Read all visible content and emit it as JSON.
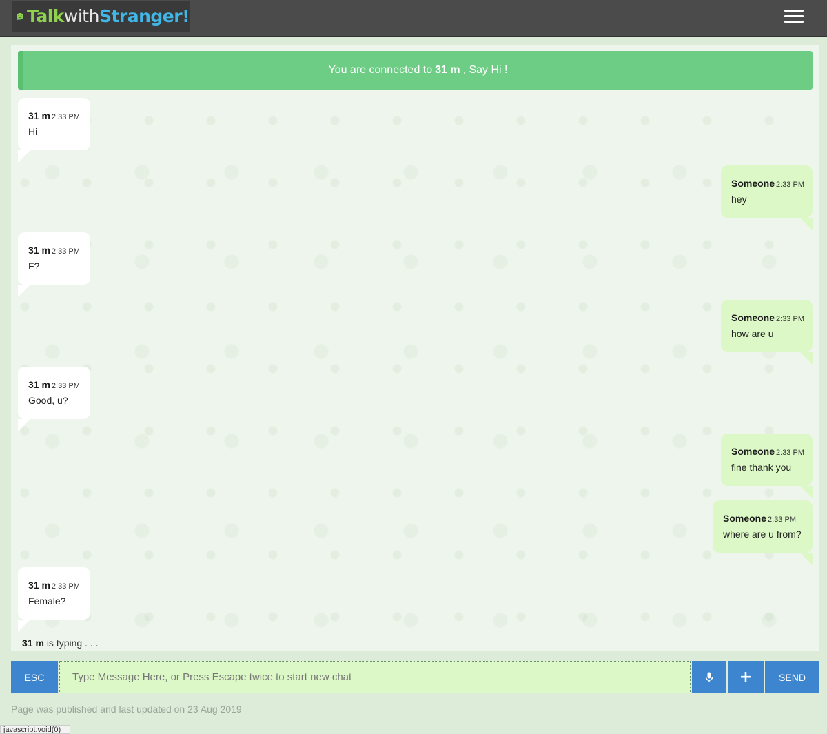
{
  "app": {
    "logo_part1": "Talk",
    "logo_part2": "with",
    "logo_part3": "Stranger!"
  },
  "banner": {
    "prefix": "You are connected to",
    "name": "31 m",
    "suffix": ", Say Hi !"
  },
  "messages": [
    {
      "side": "in",
      "name": "31 m",
      "time": "2:33 PM",
      "text": "Hi"
    },
    {
      "side": "out",
      "name": "Someone",
      "time": "2:33 PM",
      "text": "hey"
    },
    {
      "side": "in",
      "name": "31 m",
      "time": "2:33 PM",
      "text": "F?"
    },
    {
      "side": "out",
      "name": "Someone",
      "time": "2:33 PM",
      "text": "how are u"
    },
    {
      "side": "in",
      "name": "31 m",
      "time": "2:33 PM",
      "text": "Good, u?"
    },
    {
      "side": "out",
      "name": "Someone",
      "time": "2:33 PM",
      "text": "fine thank you"
    },
    {
      "side": "out",
      "name": "Someone",
      "time": "2:33 PM",
      "text": "where are u from?"
    },
    {
      "side": "in",
      "name": "31 m",
      "time": "2:33 PM",
      "text": "Female?"
    }
  ],
  "typing": {
    "name": "31 m",
    "text": "is typing . . ."
  },
  "input": {
    "esc_label": "ESC",
    "placeholder": "Type Message Here, or Press Escape twice to start new chat",
    "value": "",
    "plus_label": "+",
    "send_label": "SEND"
  },
  "footer": {
    "note": "Page was published and last updated on 23 Aug 2019"
  },
  "statusbar": {
    "text": "javascript:void(0)"
  },
  "colors": {
    "topbar": "#4b4b4b",
    "banner": "#6dcd85",
    "incoming_bubble": "#ffffff",
    "outgoing_bubble": "#dcf8c6",
    "button": "#3d86cf"
  },
  "icons": {
    "logo": "smiley-chat-icon",
    "menu": "hamburger-menu-icon",
    "mic": "microphone-icon",
    "plus": "plus-icon"
  }
}
